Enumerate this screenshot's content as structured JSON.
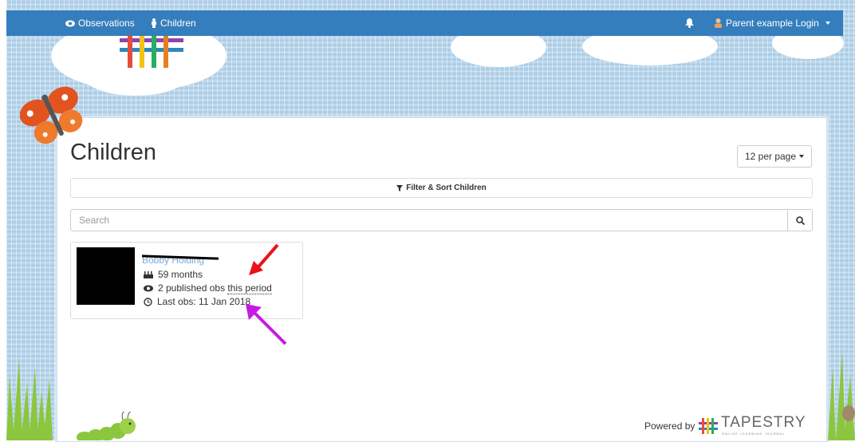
{
  "nav": {
    "observations_label": "Observations",
    "children_label": "Children",
    "user_label": "Parent example Login"
  },
  "page": {
    "title": "Children",
    "per_page_label": "12 per page",
    "filter_label": "Filter & Sort Children",
    "search_placeholder": "Search"
  },
  "child": {
    "name": "Bobby Holding",
    "age": "59 months",
    "obs_prefix": "2 published obs",
    "obs_period": "this period",
    "last_obs": "Last obs: 11 Jan 2018"
  },
  "footer": {
    "powered_by": "Powered by",
    "logo_text": "TAPESTRY",
    "logo_sub": "ONLINE LEARNING JOURNAL"
  },
  "colors": {
    "navbar": "#357ebd",
    "background": "#b4d3ea",
    "annotation_red": "#e8131b",
    "annotation_magenta": "#c51be0"
  }
}
